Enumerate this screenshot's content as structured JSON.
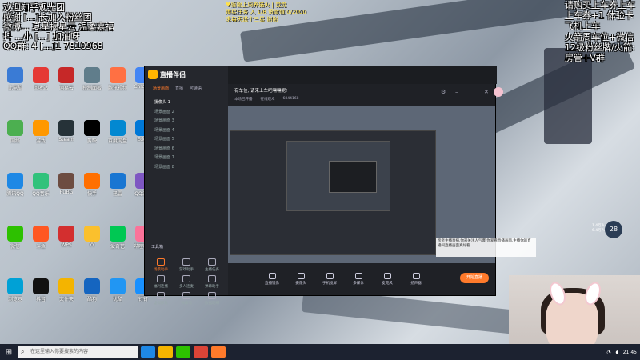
{
  "overlay_left": {
    "lines": [
      "欢迎知乎观光团",
      "感谢 [...]长加入粉丝团",
      "微博... 夏星揭星云 温柔嘉福",
      "抖 ...小 [...] 加油呀",
      "QQ群: 4 [...]1 7810968"
    ]
  },
  "overlay_right": {
    "lines": [
      "请购买上车券上车",
      "上车券+1 体验卡",
      "飞机上车",
      "火箭周车位+微信",
      "12级粉丝牌/火箭:",
      "房管+V群"
    ]
  },
  "notice": {
    "lines": [
      "♥感谢上周养猫火 | 觉觉",
      "爆星任务 入 1/8 贡献值 0/2000",
      "求每天送个三星 谢谢"
    ]
  },
  "app": {
    "name": "直播伴侣",
    "side_tabs": [
      "场景画面",
      "直播",
      "可读语"
    ],
    "scenes": [
      "摄像头 1",
      "场景画面 2",
      "场景画面 3",
      "场景画面 4",
      "场景画面 5",
      "场景画面 6",
      "场景画面 7",
      "场景画面 8"
    ],
    "tools_title": "工具箱",
    "tools": [
      {
        "label": "场景助手",
        "hot": true
      },
      {
        "label": "游戏助手",
        "hot": false
      },
      {
        "label": "主播任务",
        "hot": false
      },
      {
        "label": "福利连播",
        "hot": false
      },
      {
        "label": "多人连麦",
        "hot": false
      },
      {
        "label": "弹幕助手",
        "hot": false
      },
      {
        "label": "虚拟形象",
        "hot": false
      },
      {
        "label": "弹幕墙",
        "hot": false
      },
      {
        "label": "数据明细",
        "hot": false
      }
    ],
    "tip": "主播直播伴侣使用指南",
    "room_title": "有车位, 请来上车吧嘿嘿呢!",
    "room_meta": [
      "本场已开播",
      "在线观众",
      "6844168"
    ],
    "bottom_items": [
      "直播镜像",
      "摄像头",
      "手机投屏",
      "多媒体",
      "麦克风",
      "扬声器"
    ],
    "start_live": "开始直播"
  },
  "chat_box": {
    "text": "亲亲主播直播,你来关注人气爆,你爱看直播画面,主播你的直播间直播画面真好看"
  },
  "level_badge": "28",
  "stats": [
    "1.4万人",
    "6.4万人"
  ],
  "taskbar": {
    "search_placeholder": "在这里输入你要搜索的内容",
    "time": "21:45"
  },
  "desktop_icons": [
    "此电脑",
    "网络",
    "腾讯QQ",
    "微信",
    "浏览器",
    "回收站",
    "游戏",
    "QQ音乐",
    "斗鱼",
    "抖音",
    "网易云",
    "Steam",
    "PUBG",
    "WPS",
    "文件夹",
    "控制面板",
    "剪映",
    "快手",
    "YY",
    "酷狗",
    "腾讯视频",
    "百度网盘",
    "迅雷",
    "爱奇艺",
    "优酷",
    "Chrome",
    "Edge",
    "QQ游戏",
    "哔哩哔哩",
    "钉钉"
  ]
}
